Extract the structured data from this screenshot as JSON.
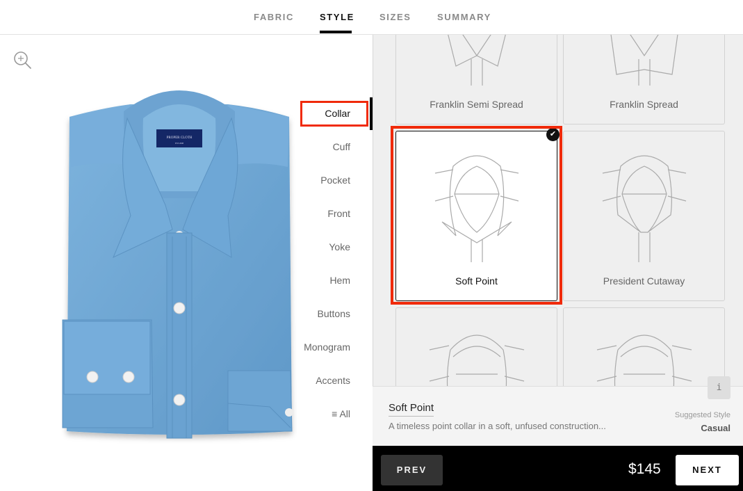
{
  "tabs": [
    {
      "label": "FABRIC",
      "active": false
    },
    {
      "label": "STYLE",
      "active": true
    },
    {
      "label": "SIZES",
      "active": false
    },
    {
      "label": "SUMMARY",
      "active": false
    }
  ],
  "preview": {
    "zoom_icon": "zoom-in-icon",
    "shirt_label_brand": "PROPER CLOTH",
    "shirt_label_sub": "EST 2008",
    "fabric_color": "#6fa6d3"
  },
  "style_menu": {
    "items": [
      {
        "label": "Collar",
        "active": true
      },
      {
        "label": "Cuff",
        "active": false
      },
      {
        "label": "Pocket",
        "active": false
      },
      {
        "label": "Front",
        "active": false
      },
      {
        "label": "Yoke",
        "active": false
      },
      {
        "label": "Hem",
        "active": false
      },
      {
        "label": "Buttons",
        "active": false
      },
      {
        "label": "Monogram",
        "active": false
      },
      {
        "label": "Accents",
        "active": false
      },
      {
        "label": "All",
        "active": false,
        "icon": "menu-lines-icon"
      }
    ]
  },
  "options": [
    {
      "label": "Franklin Semi Spread",
      "selected": false
    },
    {
      "label": "Franklin Spread",
      "selected": false
    },
    {
      "label": "Soft Point",
      "selected": true
    },
    {
      "label": "President Cutaway",
      "selected": false
    },
    {
      "label": "",
      "selected": false
    },
    {
      "label": "",
      "selected": false
    }
  ],
  "detail": {
    "info_label": "i",
    "title": "Soft Point",
    "description": "A timeless point collar in a soft, unfused construction...",
    "suggested_label": "Suggested Style",
    "suggested_value": "Casual"
  },
  "footer": {
    "prev_label": "PREV",
    "price": "$145",
    "next_label": "NEXT"
  },
  "colors": {
    "highlight": "#f02a0a",
    "accent": "#000000"
  }
}
